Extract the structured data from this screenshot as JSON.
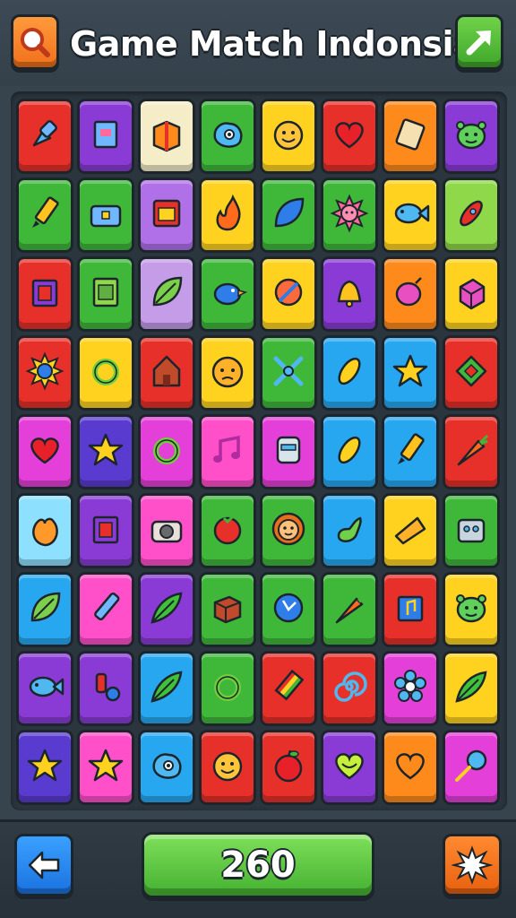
{
  "header": {
    "title": "Game Match Indonsia",
    "search_icon": "search-icon",
    "hint_icon": "arrow-up-right-icon"
  },
  "footer": {
    "score": "260",
    "back_icon": "back-arrow-icon",
    "shuffle_icon": "shuffle-burst-icon"
  },
  "colors": {
    "red": "#e8302a",
    "purple": "#8a3bd6",
    "cream": "#f4edc8",
    "green": "#3fb83a",
    "yellow": "#ffd21f",
    "orange": "#ff8a1c",
    "lime": "#8fd84a",
    "pink": "#ff4fc9",
    "blue": "#27a7f0",
    "lightblue": "#8ee0ff",
    "violet": "#b070e8",
    "magenta": "#e53fd9",
    "lilac": "#c59ce8",
    "indigo": "#5a3bd0"
  },
  "board": {
    "rows": [
      [
        {
          "bg": "red",
          "icon": "pushpin-icon"
        },
        {
          "bg": "purple",
          "icon": "book-icon"
        },
        {
          "bg": "cream",
          "icon": "gift-box-icon"
        },
        {
          "bg": "green",
          "icon": "blue-blob-icon"
        },
        {
          "bg": "yellow",
          "icon": "smiley-face-icon"
        },
        {
          "bg": "red",
          "icon": "heart-icon"
        },
        {
          "bg": "orange",
          "icon": "scroll-icon"
        },
        {
          "bg": "purple",
          "icon": "green-monster-icon"
        }
      ],
      [
        {
          "bg": "green",
          "icon": "pencil-icon"
        },
        {
          "bg": "green",
          "icon": "chest-icon"
        },
        {
          "bg": "violet",
          "icon": "radio-icon"
        },
        {
          "bg": "yellow",
          "icon": "flame-icon"
        },
        {
          "bg": "green",
          "icon": "blue-leaf-icon"
        },
        {
          "bg": "green",
          "icon": "sun-face-icon"
        },
        {
          "bg": "yellow",
          "icon": "fish-icon"
        },
        {
          "bg": "lime",
          "icon": "rocket-icon"
        }
      ],
      [
        {
          "bg": "red",
          "icon": "frame-icon"
        },
        {
          "bg": "green",
          "icon": "card-icon"
        },
        {
          "bg": "lilac",
          "icon": "leaf-icon"
        },
        {
          "bg": "green",
          "icon": "blue-bird-icon"
        },
        {
          "bg": "yellow",
          "icon": "no-sign-icon"
        },
        {
          "bg": "purple",
          "icon": "bell-icon"
        },
        {
          "bg": "orange",
          "icon": "berry-icon"
        },
        {
          "bg": "yellow",
          "icon": "cube-icon"
        }
      ],
      [
        {
          "bg": "red",
          "icon": "sun-icon"
        },
        {
          "bg": "yellow",
          "icon": "ring-icon"
        },
        {
          "bg": "red",
          "icon": "house-icon"
        },
        {
          "bg": "yellow",
          "icon": "worried-face-icon"
        },
        {
          "bg": "green",
          "icon": "crossed-swords-icon"
        },
        {
          "bg": "blue",
          "icon": "corn-icon"
        },
        {
          "bg": "blue",
          "icon": "star-icon"
        },
        {
          "bg": "red",
          "icon": "diamond-box-icon"
        }
      ],
      [
        {
          "bg": "magenta",
          "icon": "heart-icon"
        },
        {
          "bg": "indigo",
          "icon": "star-icon"
        },
        {
          "bg": "magenta",
          "icon": "ring-icon"
        },
        {
          "bg": "pink",
          "icon": "music-note-icon"
        },
        {
          "bg": "magenta",
          "icon": "robot-head-icon"
        },
        {
          "bg": "blue",
          "icon": "corn-icon"
        },
        {
          "bg": "blue",
          "icon": "pencil-icon"
        },
        {
          "bg": "red",
          "icon": "carrot-icon"
        }
      ],
      [
        {
          "bg": "lightblue",
          "icon": "peach-icon"
        },
        {
          "bg": "purple",
          "icon": "frame-icon"
        },
        {
          "bg": "pink",
          "icon": "camera-icon"
        },
        {
          "bg": "green",
          "icon": "tomato-icon"
        },
        {
          "bg": "green",
          "icon": "lion-face-icon"
        },
        {
          "bg": "blue",
          "icon": "gourd-icon"
        },
        {
          "bg": "yellow",
          "icon": "cheese-icon"
        },
        {
          "bg": "green",
          "icon": "toy-robot-icon"
        }
      ],
      [
        {
          "bg": "blue",
          "icon": "leaf-icon"
        },
        {
          "bg": "pink",
          "icon": "crayon-icon"
        },
        {
          "bg": "purple",
          "icon": "green-leaf-icon"
        },
        {
          "bg": "green",
          "icon": "crate-icon"
        },
        {
          "bg": "green",
          "icon": "clock-icon"
        },
        {
          "bg": "green",
          "icon": "carrot-icon"
        },
        {
          "bg": "red",
          "icon": "music-frame-icon"
        },
        {
          "bg": "yellow",
          "icon": "green-monster-icon"
        }
      ],
      [
        {
          "bg": "purple",
          "icon": "fish-icon"
        },
        {
          "bg": "purple",
          "icon": "toy-car-icon"
        },
        {
          "bg": "blue",
          "icon": "green-leaf-icon"
        },
        {
          "bg": "green",
          "icon": "ring-icon"
        },
        {
          "bg": "red",
          "icon": "rainbow-pencil-icon"
        },
        {
          "bg": "red",
          "icon": "spiral-icon"
        },
        {
          "bg": "magenta",
          "icon": "flower-icon"
        },
        {
          "bg": "yellow",
          "icon": "green-leaf-icon"
        }
      ],
      [
        {
          "bg": "indigo",
          "icon": "star-icon"
        },
        {
          "bg": "pink",
          "icon": "star-icon"
        },
        {
          "bg": "blue",
          "icon": "blue-blob-icon"
        },
        {
          "bg": "red",
          "icon": "smiley-face-icon"
        },
        {
          "bg": "red",
          "icon": "apple-icon"
        },
        {
          "bg": "purple",
          "icon": "green-heart-icon"
        },
        {
          "bg": "orange",
          "icon": "orange-heart-icon"
        },
        {
          "bg": "magenta",
          "icon": "lollipop-icon"
        }
      ]
    ]
  }
}
